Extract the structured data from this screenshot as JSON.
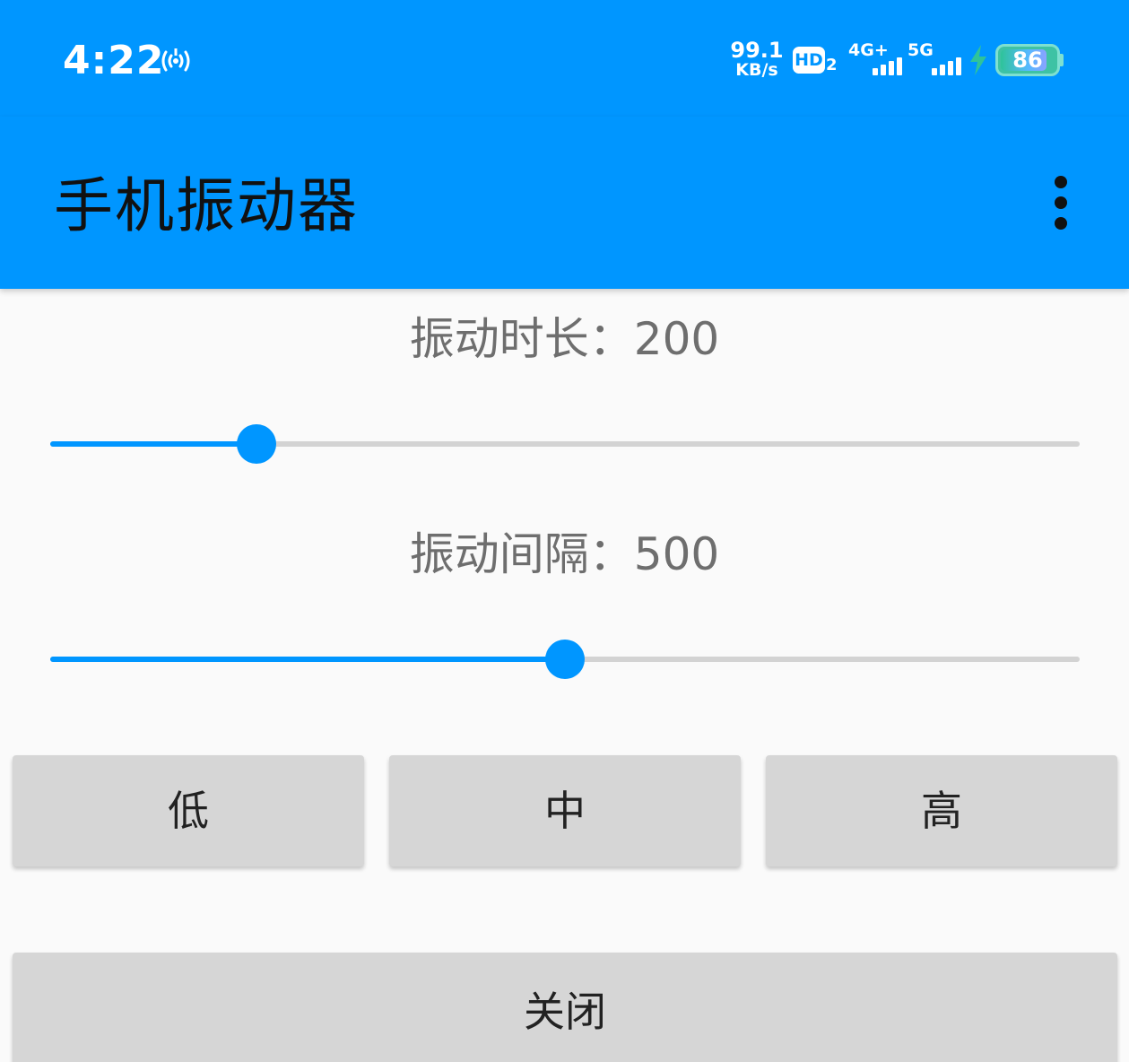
{
  "status_bar": {
    "time": "4:22",
    "network_speed_value": "99.1",
    "network_speed_unit": "KB/s",
    "hd_badge": "HD",
    "hd_sub": "2",
    "sim1_label": "4G+",
    "sim2_label": "5G",
    "battery_level": 86,
    "battery_text": "86",
    "colors": {
      "background": "#0096ff",
      "battery": "#3ec2a4"
    }
  },
  "app_bar": {
    "title": "手机振动器",
    "overflow_icon": "more-vertical-icon",
    "background": "#0096ff"
  },
  "controls": {
    "duration": {
      "label": "振动时长：200",
      "slider_fraction": 0.2
    },
    "interval": {
      "label": "振动间隔：500",
      "slider_fraction": 0.5
    },
    "accent_color": "#0096ff"
  },
  "buttons": {
    "low": "低",
    "medium": "中",
    "high": "高",
    "off": "关闭"
  }
}
